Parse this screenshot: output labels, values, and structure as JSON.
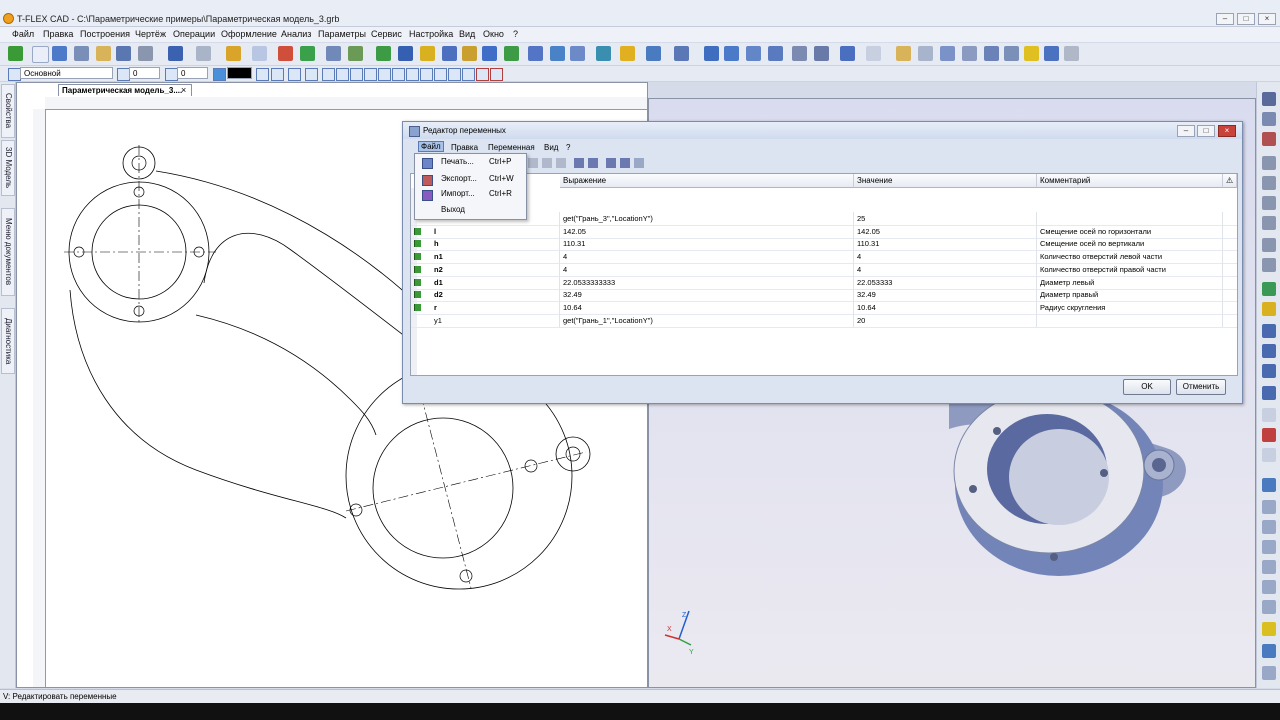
{
  "window": {
    "title": "T-FLEX CAD - C:\\Параметрические примеры\\Параметрическая модель_3.grb"
  },
  "menubar": [
    "Файл",
    "Правка",
    "Построения",
    "Чертёж",
    "Операции",
    "Оформление",
    "Анализ",
    "Параметры",
    "Сервис",
    "Настройка",
    "Вид",
    "Окно",
    "?"
  ],
  "toolbar2": {
    "layer": "Основной",
    "value1": "0",
    "value2": "0"
  },
  "left_tabs": [
    "Свойства",
    "3D Модель",
    "Меню документов",
    "Диагностика"
  ],
  "document_tab": "Параметрическая модель_3....",
  "dialog": {
    "title": "Редактор переменных",
    "menu": [
      "Файл",
      "Правка",
      "Переменная",
      "Вид",
      "?"
    ],
    "columns": [
      "Выражение",
      "Значение",
      "Комментарий"
    ],
    "rows": [
      {
        "name": "",
        "expr": "get(\"Грань_3\",\"LocationY\")",
        "value": "25",
        "comment": "",
        "flag": false
      },
      {
        "name": "l",
        "expr": "142.05",
        "value": "142.05",
        "comment": "Смещение осей по горизонтали",
        "flag": true
      },
      {
        "name": "h",
        "expr": "110.31",
        "value": "110.31",
        "comment": "Смещение осей по вертикали",
        "flag": true
      },
      {
        "name": "n1",
        "expr": "4",
        "value": "4",
        "comment": "Количество отверстий левой части",
        "flag": true
      },
      {
        "name": "n2",
        "expr": "4",
        "value": "4",
        "comment": "Количество отверстий правой части",
        "flag": true
      },
      {
        "name": "d1",
        "expr": "22.0533333333",
        "value": "22.053333",
        "comment": "Диаметр левый",
        "flag": true
      },
      {
        "name": "d2",
        "expr": "32.49",
        "value": "32.49",
        "comment": "Диаметр правый",
        "flag": true
      },
      {
        "name": "r",
        "expr": "10.64",
        "value": "10.64",
        "comment": "Радиус скругления",
        "flag": true
      },
      {
        "name": "y1",
        "expr": "get(\"Грань_1\",\"LocationY\")",
        "value": "20",
        "comment": "",
        "flag": false
      }
    ],
    "ok": "OK",
    "cancel": "Отменить"
  },
  "file_menu": [
    {
      "label": "Печать...",
      "shortcut": "Ctrl+P"
    },
    {
      "label": "Экспорт...",
      "shortcut": "Ctrl+W"
    },
    {
      "label": "Импорт...",
      "shortcut": "Ctrl+R"
    },
    {
      "label": "Выход",
      "shortcut": ""
    }
  ],
  "status": "V: Редактировать переменные",
  "axis_labels": {
    "x": "X",
    "y": "Y",
    "z": "Z"
  },
  "colors": {
    "accent": "#3a6ea5",
    "model_body": "#7f8fb5",
    "flag": "#3a9a35"
  }
}
